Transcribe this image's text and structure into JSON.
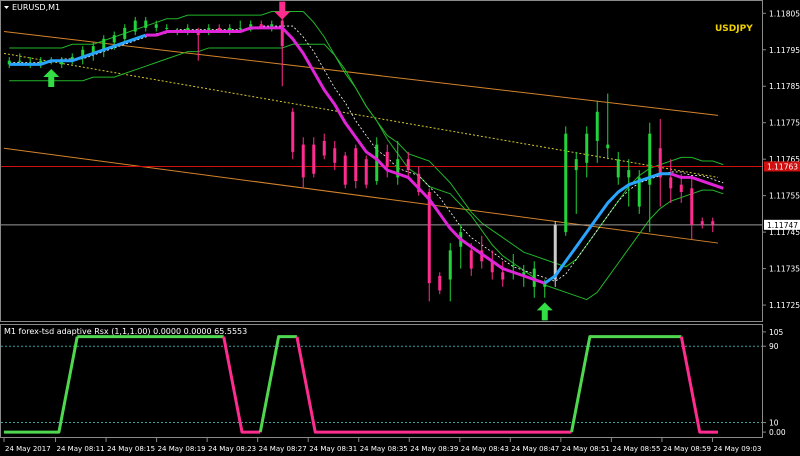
{
  "window": {
    "main_title": "EURUSD,M1",
    "symbol_label": "USDJPY",
    "indicator_title": "M1 forex-tsd adaptive Rsx (1,1,1.00) 0.0000 0.0000 65.5553"
  },
  "colors": {
    "bull": "#22d33a",
    "bear": "#ff2c8f",
    "white_candle": "#cccccc",
    "ma_up": "#2aa5ff",
    "ma_down": "#e024d8",
    "env": "#d4832c",
    "env_dotted": "#d4c82c",
    "envelope_green": "#22b52a",
    "hline_red": "#d01010",
    "hline_gray": "#9a9a9a",
    "rsx_up": "#4fd84f",
    "rsx_down": "#ff2c8f",
    "level_line": "#3aa0a0",
    "arrow_up": "#33dd44",
    "arrow_down": "#ff2c8f"
  },
  "chart_data": [
    {
      "type": "candlestick",
      "symbol": "EURUSD",
      "timeframe": "M1",
      "ylim": [
        1.11722,
        1.11807
      ],
      "y_ticks": [
        "1.11805",
        "1.11795",
        "1.11785",
        "1.11775",
        "1.11765",
        "1.11755",
        "1.11745",
        "1.11735",
        "1.11725"
      ],
      "y_tick_values": [
        1.11805,
        1.11795,
        1.11785,
        1.11775,
        1.11765,
        1.11755,
        1.11745,
        1.11735,
        1.11725
      ],
      "price_labels": [
        {
          "text": "1.11763",
          "value": 1.11763,
          "color": "red"
        },
        {
          "text": "1.11747",
          "value": 1.11747,
          "color": "white"
        }
      ],
      "x_ticks": [
        "24 May 2017",
        "24 May 08:11",
        "24 May 08:15",
        "24 May 08:19",
        "24 May 08:23",
        "24 May 08:27",
        "24 May 08:31",
        "24 May 08:35",
        "24 May 08:39",
        "24 May 08:43",
        "24 May 08:47",
        "24 May 08:51",
        "24 May 08:55",
        "24 May 08:59",
        "24 May 09:03"
      ],
      "candles": [
        {
          "o": 1.11791,
          "h": 1.11793,
          "l": 1.1179,
          "c": 1.11792
        },
        {
          "o": 1.11792,
          "h": 1.11794,
          "l": 1.11791,
          "c": 1.11792
        },
        {
          "o": 1.11791,
          "h": 1.11793,
          "l": 1.1179,
          "c": 1.11791
        },
        {
          "o": 1.11791,
          "h": 1.11793,
          "l": 1.1179,
          "c": 1.11792
        },
        {
          "o": 1.11792,
          "h": 1.11793,
          "l": 1.11791,
          "c": 1.11792
        },
        {
          "o": 1.11791,
          "h": 1.11793,
          "l": 1.1179,
          "c": 1.11792
        },
        {
          "o": 1.11792,
          "h": 1.11794,
          "l": 1.11791,
          "c": 1.11793
        },
        {
          "o": 1.11793,
          "h": 1.11796,
          "l": 1.11791,
          "c": 1.11795
        },
        {
          "o": 1.11794,
          "h": 1.11797,
          "l": 1.11792,
          "c": 1.11796
        },
        {
          "o": 1.11795,
          "h": 1.11799,
          "l": 1.11793,
          "c": 1.11798
        },
        {
          "o": 1.11797,
          "h": 1.118,
          "l": 1.11795,
          "c": 1.11799
        },
        {
          "o": 1.11798,
          "h": 1.11802,
          "l": 1.11797,
          "c": 1.11801
        },
        {
          "o": 1.118,
          "h": 1.11804,
          "l": 1.11799,
          "c": 1.11803
        },
        {
          "o": 1.11801,
          "h": 1.11804,
          "l": 1.118,
          "c": 1.11803
        },
        {
          "o": 1.11801,
          "h": 1.11803,
          "l": 1.118,
          "c": 1.11802
        },
        {
          "o": 1.11801,
          "h": 1.11802,
          "l": 1.118,
          "c": 1.11801
        },
        {
          "o": 1.118,
          "h": 1.11801,
          "l": 1.11799,
          "c": 1.118
        },
        {
          "o": 1.118,
          "h": 1.11802,
          "l": 1.11799,
          "c": 1.11801
        },
        {
          "o": 1.118,
          "h": 1.11801,
          "l": 1.11792,
          "c": 1.11799
        },
        {
          "o": 1.118,
          "h": 1.11802,
          "l": 1.11799,
          "c": 1.11801
        },
        {
          "o": 1.11801,
          "h": 1.11802,
          "l": 1.118,
          "c": 1.118
        },
        {
          "o": 1.118,
          "h": 1.11802,
          "l": 1.11799,
          "c": 1.11801
        },
        {
          "o": 1.11801,
          "h": 1.11803,
          "l": 1.118,
          "c": 1.11801
        },
        {
          "o": 1.11801,
          "h": 1.11803,
          "l": 1.118,
          "c": 1.11802
        },
        {
          "o": 1.11802,
          "h": 1.11803,
          "l": 1.11801,
          "c": 1.11801
        },
        {
          "o": 1.11801,
          "h": 1.11803,
          "l": 1.118,
          "c": 1.11802
        },
        {
          "o": 1.11803,
          "h": 1.11804,
          "l": 1.11785,
          "c": 1.11796
        },
        {
          "o": 1.11778,
          "h": 1.11779,
          "l": 1.11765,
          "c": 1.11767
        },
        {
          "o": 1.11769,
          "h": 1.11771,
          "l": 1.11757,
          "c": 1.1176
        },
        {
          "o": 1.11769,
          "h": 1.11771,
          "l": 1.1176,
          "c": 1.11761
        },
        {
          "o": 1.1177,
          "h": 1.11772,
          "l": 1.11765,
          "c": 1.11766
        },
        {
          "o": 1.11768,
          "h": 1.1177,
          "l": 1.11762,
          "c": 1.11764
        },
        {
          "o": 1.11766,
          "h": 1.11767,
          "l": 1.11757,
          "c": 1.11758
        },
        {
          "o": 1.11768,
          "h": 1.11769,
          "l": 1.11757,
          "c": 1.11759
        },
        {
          "o": 1.11765,
          "h": 1.11766,
          "l": 1.11757,
          "c": 1.11758
        },
        {
          "o": 1.11759,
          "h": 1.11771,
          "l": 1.11758,
          "c": 1.11769
        },
        {
          "o": 1.11767,
          "h": 1.11769,
          "l": 1.1176,
          "c": 1.11763
        },
        {
          "o": 1.1176,
          "h": 1.1177,
          "l": 1.11758,
          "c": 1.11765
        },
        {
          "o": 1.11765,
          "h": 1.11767,
          "l": 1.1176,
          "c": 1.11762
        },
        {
          "o": 1.11761,
          "h": 1.11763,
          "l": 1.11755,
          "c": 1.11756
        },
        {
          "o": 1.11756,
          "h": 1.11757,
          "l": 1.11726,
          "c": 1.11731
        },
        {
          "o": 1.11733,
          "h": 1.11734,
          "l": 1.11728,
          "c": 1.11729
        },
        {
          "o": 1.11732,
          "h": 1.11742,
          "l": 1.11726,
          "c": 1.1174
        },
        {
          "o": 1.11741,
          "h": 1.11747,
          "l": 1.11735,
          "c": 1.11745
        },
        {
          "o": 1.1174,
          "h": 1.11742,
          "l": 1.11733,
          "c": 1.11735
        },
        {
          "o": 1.1174,
          "h": 1.11744,
          "l": 1.11735,
          "c": 1.11737
        },
        {
          "o": 1.11737,
          "h": 1.1174,
          "l": 1.11732,
          "c": 1.11734
        },
        {
          "o": 1.11734,
          "h": 1.11737,
          "l": 1.1173,
          "c": 1.11732
        },
        {
          "o": 1.11736,
          "h": 1.11739,
          "l": 1.11732,
          "c": 1.11736
        },
        {
          "o": 1.11733,
          "h": 1.11736,
          "l": 1.1173,
          "c": 1.11734
        },
        {
          "o": 1.1173,
          "h": 1.11737,
          "l": 1.11727,
          "c": 1.11735
        },
        {
          "o": 1.1173,
          "h": 1.11732,
          "l": 1.11727,
          "c": 1.11731
        },
        {
          "o": 1.11732,
          "h": 1.11748,
          "l": 1.1173,
          "c": 1.11747
        },
        {
          "o": 1.11745,
          "h": 1.11774,
          "l": 1.11744,
          "c": 1.11772
        },
        {
          "o": 1.11762,
          "h": 1.11767,
          "l": 1.1175,
          "c": 1.11765
        },
        {
          "o": 1.11764,
          "h": 1.11774,
          "l": 1.1176,
          "c": 1.11772
        },
        {
          "o": 1.1177,
          "h": 1.11781,
          "l": 1.11764,
          "c": 1.11778
        },
        {
          "o": 1.11768,
          "h": 1.11783,
          "l": 1.11765,
          "c": 1.11769
        },
        {
          "o": 1.1176,
          "h": 1.11767,
          "l": 1.11758,
          "c": 1.11765
        },
        {
          "o": 1.1176,
          "h": 1.11765,
          "l": 1.11752,
          "c": 1.11762
        },
        {
          "o": 1.11752,
          "h": 1.11762,
          "l": 1.1175,
          "c": 1.1176
        },
        {
          "o": 1.11758,
          "h": 1.11775,
          "l": 1.11745,
          "c": 1.11772
        },
        {
          "o": 1.11768,
          "h": 1.11776,
          "l": 1.11752,
          "c": 1.1176
        },
        {
          "o": 1.1176,
          "h": 1.11765,
          "l": 1.11753,
          "c": 1.11757
        },
        {
          "o": 1.11758,
          "h": 1.11761,
          "l": 1.11753,
          "c": 1.11756
        },
        {
          "o": 1.11757,
          "h": 1.1176,
          "l": 1.11743,
          "c": 1.11747
        },
        {
          "o": 1.11748,
          "h": 1.11749,
          "l": 1.11746,
          "c": 1.11747
        },
        {
          "o": 1.11748,
          "h": 1.11749,
          "l": 1.11745,
          "c": 1.11747
        }
      ],
      "ma": [
        1.11791,
        1.11791,
        1.11791,
        1.11791,
        1.11792,
        1.11792,
        1.11792,
        1.11793,
        1.11794,
        1.11795,
        1.11796,
        1.11797,
        1.11798,
        1.11799,
        1.11799,
        1.118,
        1.118,
        1.118,
        1.118,
        1.118,
        1.118,
        1.118,
        1.118,
        1.11801,
        1.11801,
        1.11801,
        1.11801,
        1.11798,
        1.11794,
        1.11789,
        1.11784,
        1.1178,
        1.11775,
        1.11771,
        1.11767,
        1.11765,
        1.11762,
        1.11761,
        1.1176,
        1.11757,
        1.11754,
        1.1175,
        1.11746,
        1.11743,
        1.11741,
        1.11739,
        1.11737,
        1.11735,
        1.11734,
        1.11733,
        1.11732,
        1.11731,
        1.11733,
        1.11737,
        1.11741,
        1.11745,
        1.11749,
        1.11753,
        1.11756,
        1.11758,
        1.11759,
        1.1176,
        1.11761,
        1.11761,
        1.1176,
        1.1176,
        1.11759,
        1.11758,
        1.11757
      ],
      "ma_color_change": [
        {
          "from": 0,
          "to": 13,
          "state": "up"
        },
        {
          "from": 13,
          "to": 51,
          "state": "down"
        },
        {
          "from": 51,
          "to": 63,
          "state": "up"
        },
        {
          "from": 63,
          "to": 68,
          "state": "down"
        }
      ],
      "arrows": [
        {
          "index": 4,
          "direction": "up",
          "price": 1.11787
        },
        {
          "index": 26,
          "direction": "down",
          "price": 1.11806
        },
        {
          "index": 51,
          "direction": "up",
          "price": 1.11723
        }
      ]
    },
    {
      "type": "line",
      "title": "M1 forex-tsd adaptive Rsx (1,1,1.00) 0.0000 0.0000 65.5553",
      "ylim": [
        -2,
        107
      ],
      "y_ticks": [
        "105",
        "90",
        "10",
        "0.00"
      ],
      "y_tick_values": [
        105,
        90,
        10,
        0
      ],
      "levels": [
        90,
        10
      ],
      "points": [
        {
          "i": 0,
          "v": 0
        },
        {
          "i": 3,
          "v": 0
        },
        {
          "i": 4,
          "v": 100
        },
        {
          "i": 12,
          "v": 100
        },
        {
          "i": 13,
          "v": 0
        },
        {
          "i": 14,
          "v": 0
        },
        {
          "i": 15,
          "v": 100
        },
        {
          "i": 16,
          "v": 100
        },
        {
          "i": 17,
          "v": 0
        },
        {
          "i": 31,
          "v": 0
        },
        {
          "i": 32,
          "v": 100
        },
        {
          "i": 37,
          "v": 100
        },
        {
          "i": 38,
          "v": 0
        },
        {
          "i": 39,
          "v": 0
        }
      ],
      "x_span": [
        0,
        39
      ],
      "color_segments": [
        {
          "from": 0,
          "to": 4,
          "state": "up"
        },
        {
          "from": 4,
          "to": 12,
          "state": "up"
        },
        {
          "from": 12,
          "to": 14,
          "state": "down"
        },
        {
          "from": 14,
          "to": 16,
          "state": "up"
        },
        {
          "from": 16,
          "to": 31,
          "state": "down"
        },
        {
          "from": 31,
          "to": 37,
          "state": "up"
        },
        {
          "from": 37,
          "to": 39,
          "state": "down"
        }
      ]
    }
  ]
}
